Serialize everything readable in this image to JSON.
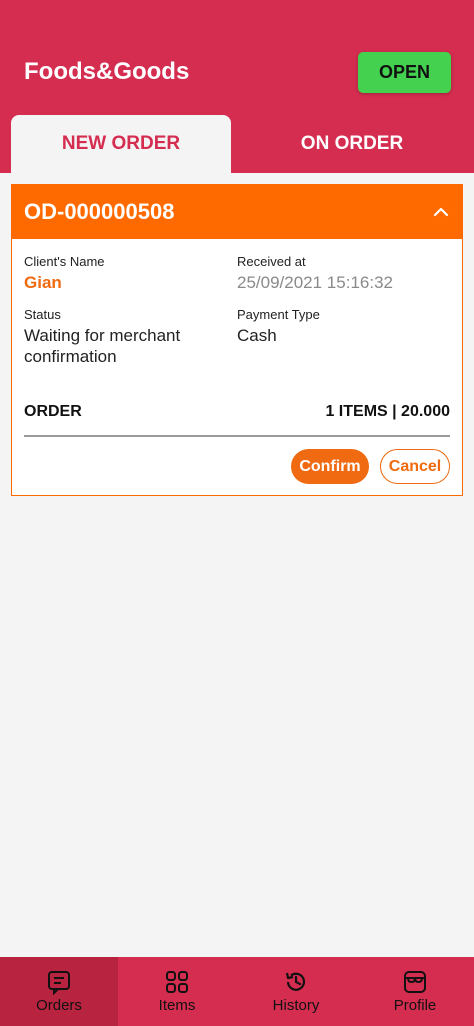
{
  "header": {
    "title": "Foods&Goods",
    "status_button": "OPEN"
  },
  "tabs": [
    {
      "label": "NEW ORDER",
      "active": true
    },
    {
      "label": "ON ORDER",
      "active": false
    }
  ],
  "order": {
    "id": "OD-000000508",
    "client_name_label": "Client's Name",
    "client_name": "Gian",
    "received_label": "Received at",
    "received_at": "25/09/2021 15:16:32",
    "status_label": "Status",
    "status": "Waiting for merchant confirmation",
    "payment_label": "Payment Type",
    "payment_type": "Cash",
    "order_label": "ORDER",
    "order_summary": "1 ITEMS | 20.000",
    "confirm_label": "Confirm",
    "cancel_label": "Cancel"
  },
  "bottom_nav": [
    {
      "label": "Orders",
      "icon": "orders-icon",
      "active": true
    },
    {
      "label": "Items",
      "icon": "grid-icon",
      "active": false
    },
    {
      "label": "History",
      "icon": "history-icon",
      "active": false
    },
    {
      "label": "Profile",
      "icon": "store-icon",
      "active": false
    }
  ],
  "colors": {
    "primary": "#d42d50",
    "accent": "#ff6a00",
    "open": "#43d14f"
  }
}
